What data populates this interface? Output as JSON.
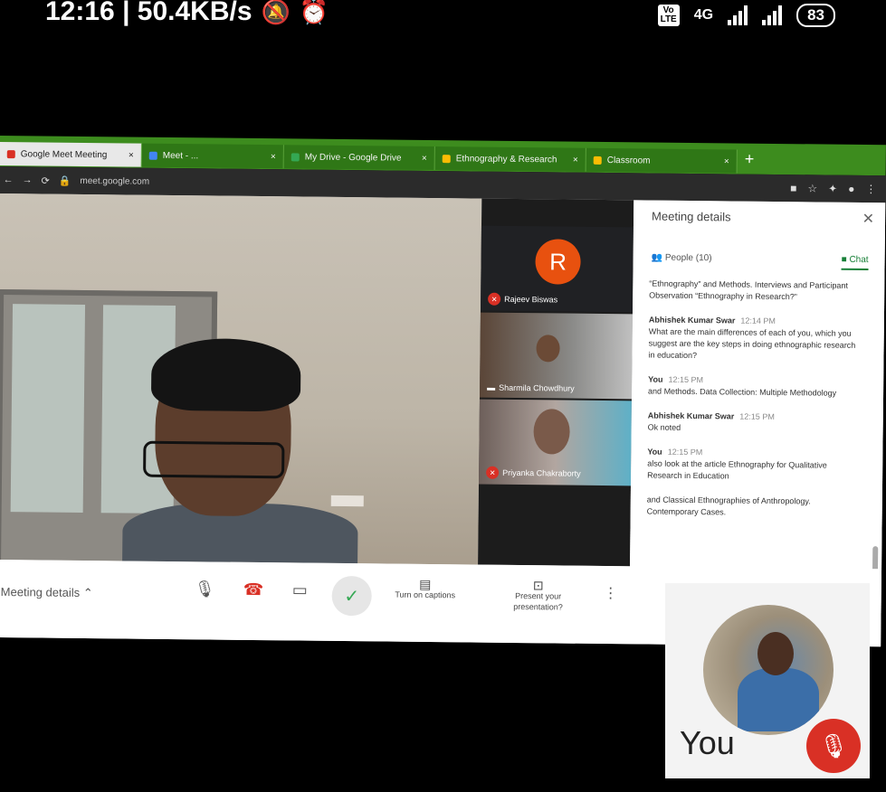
{
  "status_bar": {
    "time_speed": "12:16 | 50.4KB/s",
    "network": "4G",
    "battery": "83"
  },
  "browser": {
    "tabs": [
      {
        "label": "Google Meet Meeting"
      },
      {
        "label": "Meet - ..."
      },
      {
        "label": "My Drive - Google Drive"
      },
      {
        "label": "Ethnography & Research"
      },
      {
        "label": "Classroom"
      }
    ],
    "url": "meet.google.com"
  },
  "meeting": {
    "participants": [
      {
        "initial": "R",
        "name": "Rajeev Biswas"
      },
      {
        "name": "Sharmila Chowdhury"
      },
      {
        "name": "Priyanka Chakraborty"
      }
    ],
    "panel": {
      "title": "Meeting details",
      "tab_people": "People (10)",
      "tab_chat": "Chat",
      "messages": [
        {
          "who": "",
          "time": "",
          "text": "“Ethnography” and Methods. Interviews and Participant Observation “Ethnography in Research?”"
        },
        {
          "who": "Abhishek Kumar Swar",
          "time": "12:14 PM",
          "text": "What are the main differences of each of you, which you suggest are the key steps in doing ethnographic research in education?"
        },
        {
          "who": "You",
          "time": "12:15 PM",
          "text": "and Methods. Data Collection: Multiple Methodology"
        },
        {
          "who": "Abhishek Kumar Swar",
          "time": "12:15 PM",
          "text": "Ok noted"
        },
        {
          "who": "You",
          "time": "12:15 PM",
          "text": "also look at the article Ethnography for Qualitative Research in Education"
        },
        {
          "who": "",
          "time": "",
          "text": "and Classical Ethnographies of Anthropology. Contemporary Cases."
        }
      ]
    },
    "bottom": {
      "meeting_details": "Meeting details",
      "captions": "Turn on captions",
      "present": "Present your presentation?"
    },
    "self": {
      "label": "You"
    }
  }
}
